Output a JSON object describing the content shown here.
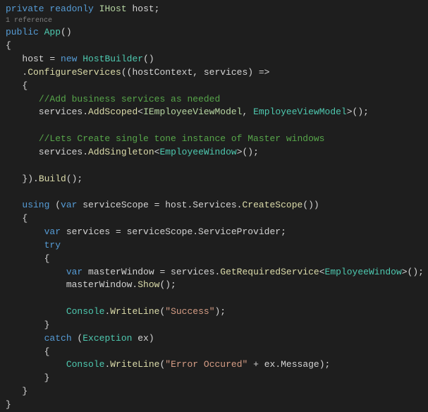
{
  "code": {
    "l0_private": "private",
    "l0_readonly": "readonly",
    "l0_ihost": "IHost",
    "l0_host": " host;",
    "ref": "1 reference",
    "l1_public": "public",
    "l1_app": "App",
    "l1_paren": "()",
    "l2_brace": "{",
    "l3_pre": "   host = ",
    "l3_new": "new",
    "l3_sp": " ",
    "l3_hb": "HostBuilder",
    "l3_paren": "()",
    "l4_pre": "   .",
    "l4_conf": "ConfigureServices",
    "l4_rest": "((hostContext, services) =>",
    "l5": "   {",
    "l6_pre": "      ",
    "l6_comment": "//Add business services as needed",
    "l7_pre": "      services.",
    "l7_add": "AddScoped",
    "l7_lt": "<",
    "l7_iemp": "IEmployeeViewModel",
    "l7_comma": ", ",
    "l7_emp": "EmployeeViewModel",
    "l7_end": ">();",
    "l8_blank": " ",
    "l9_pre": "      ",
    "l9_comment": "//Lets Create single tone instance of Master windows",
    "l10_pre": "      services.",
    "l10_add": "AddSingleton",
    "l10_lt": "<",
    "l10_win": "EmployeeWindow",
    "l10_end": ">();",
    "l11_blank": " ",
    "l12": "   }).",
    "l12_build": "Build",
    "l12_end": "();",
    "l13_blank": " ",
    "l14_pre": "   ",
    "l14_using": "using",
    "l14_sp": " (",
    "l14_var": "var",
    "l14_scope": " serviceScope = host.Services.",
    "l14_create": "CreateScope",
    "l14_end": "())",
    "l15": "   {",
    "l16_pre": "       ",
    "l16_var": "var",
    "l16_rest": " services = serviceScope.ServiceProvider;",
    "l17_pre": "       ",
    "l17_try": "try",
    "l18": "       {",
    "l19_pre": "           ",
    "l19_var": "var",
    "l19_mw": " masterWindow = services.",
    "l19_get": "GetRequiredService",
    "l19_lt": "<",
    "l19_win": "EmployeeWindow",
    "l19_end": ">();",
    "l20_pre": "           masterWindow.",
    "l20_show": "Show",
    "l20_end": "();",
    "l21_blank": " ",
    "l22_pre": "           ",
    "l22_console": "Console",
    "l22_wl": ".",
    "l22_write": "WriteLine",
    "l22_op": "(",
    "l22_str": "\"Success\"",
    "l22_end": ");",
    "l23": "       }",
    "l24_pre": "       ",
    "l24_catch": "catch",
    "l24_sp": " (",
    "l24_ex": "Exception",
    "l24_exv": " ex)",
    "l25": "       {",
    "l26_pre": "           ",
    "l26_console": "Console",
    "l26_dot": ".",
    "l26_write": "WriteLine",
    "l26_op": "(",
    "l26_str": "\"Error Occured\"",
    "l26_plus": " + ex.Message);",
    "l27": "       }",
    "l28": "   }",
    "l29": "}"
  }
}
